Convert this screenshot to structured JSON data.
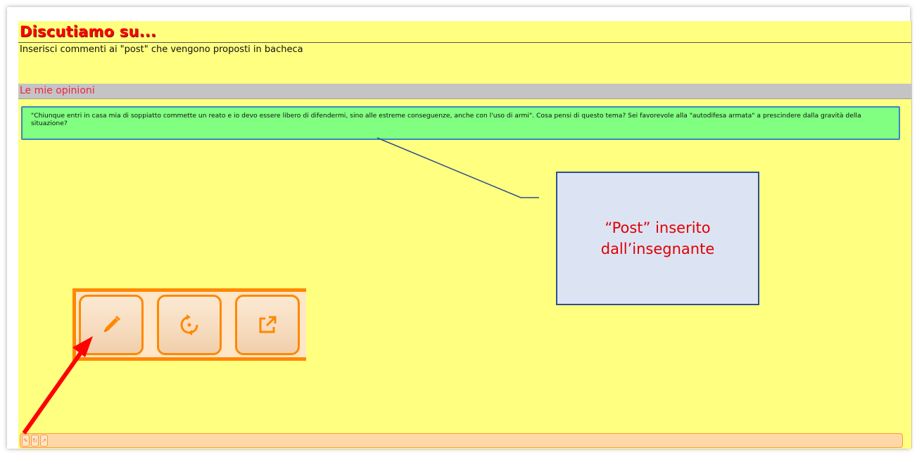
{
  "header": {
    "title": "Discutiamo su...",
    "subtitle": "Inserisci commenti ai \"post\" che vengono proposti in bacheca"
  },
  "section": {
    "title": "Le mie opinioni"
  },
  "post": {
    "text": "\"Chiunque entri in casa mia di soppiatto commette un reato e io devo essere libero di difendermi, sino alle estreme conseguenze, anche con l'uso di armi\". Cosa pensi di questo tema? Sei favorevole alla \"autodifesa armata\" a prescindere dalla gravità della situazione?"
  },
  "annotation": {
    "callout_text": "“Post” inserito dall’insegnante"
  },
  "toolbar": {
    "buttons": [
      {
        "icon": "pencil-icon"
      },
      {
        "icon": "refresh-icon"
      },
      {
        "icon": "external-link-icon"
      }
    ]
  },
  "colors": {
    "page_background": "#ffff80",
    "title": "#ff0000",
    "section_title": "#ee2244",
    "post_background": "#80ff80",
    "post_border": "#3a85c8",
    "toolbar_accent": "#ff8800",
    "callout_background": "#dce4f4",
    "callout_text": "#e00000",
    "arrow": "#ff0000"
  }
}
